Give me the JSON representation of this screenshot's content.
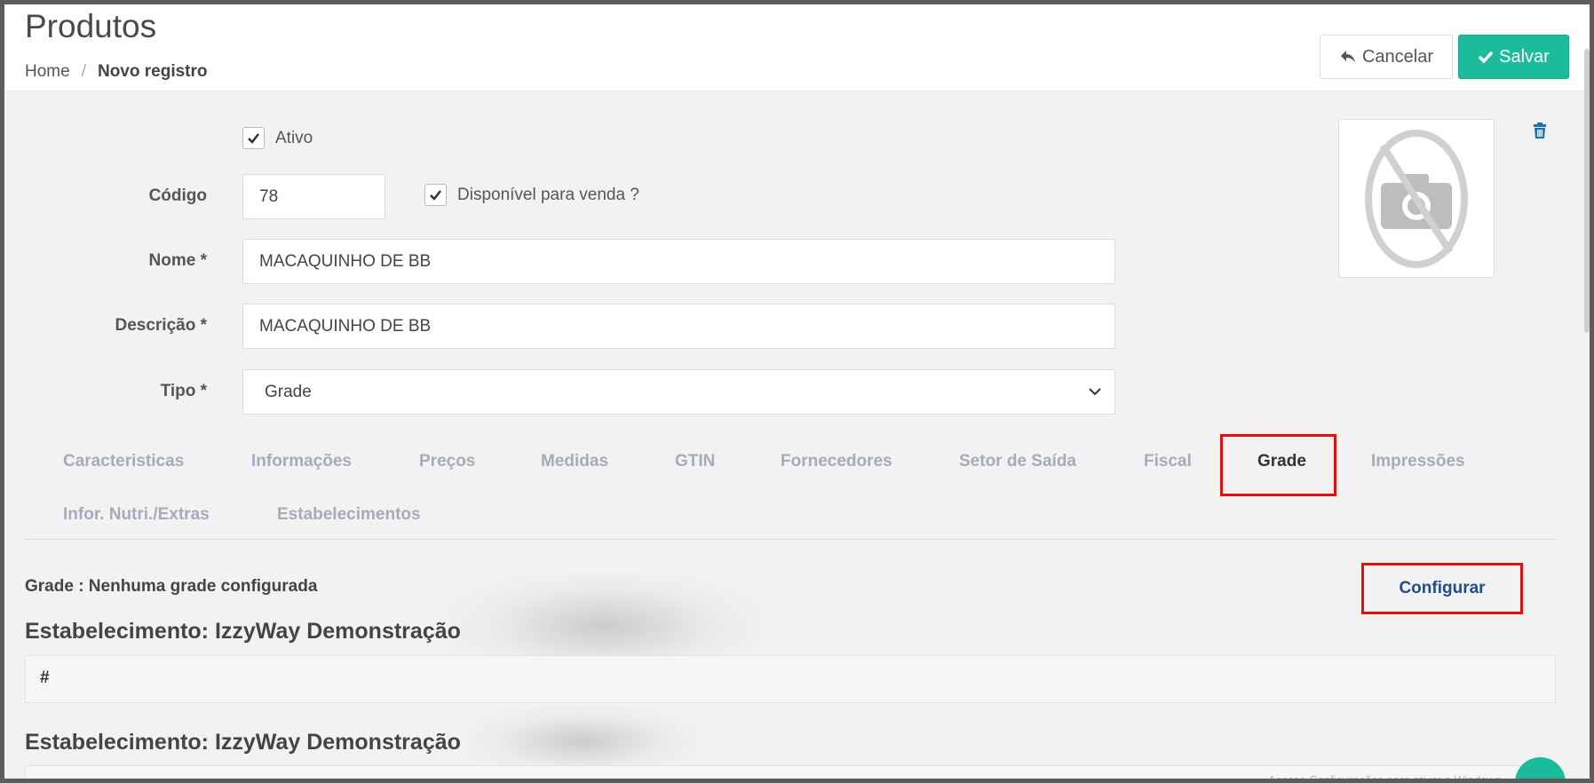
{
  "header": {
    "title": "Produtos",
    "breadcrumb_home": "Home",
    "breadcrumb_separator": "/",
    "breadcrumb_current": "Novo registro",
    "cancel_label": "Cancelar",
    "save_label": "Salvar"
  },
  "form": {
    "ativo_label": "Ativo",
    "ativo_checked": true,
    "codigo_label": "Código",
    "codigo_value": "78",
    "disponivel_label": "Disponível para venda ?",
    "disponivel_checked": true,
    "nome_label": "Nome *",
    "nome_value": "MACAQUINHO DE BB",
    "descricao_label": "Descrição *",
    "descricao_value": "MACAQUINHO DE BB",
    "tipo_label": "Tipo *",
    "tipo_value": "Grade"
  },
  "tabs": [
    {
      "label": "Caracteristicas"
    },
    {
      "label": "Informações"
    },
    {
      "label": "Preços"
    },
    {
      "label": "Medidas"
    },
    {
      "label": "GTIN"
    },
    {
      "label": "Fornecedores"
    },
    {
      "label": "Setor de Saída"
    },
    {
      "label": "Fiscal"
    },
    {
      "label": "Grade",
      "active": true
    },
    {
      "label": "Impressões"
    },
    {
      "label": "Infor. Nutri./Extras"
    },
    {
      "label": "Estabelecimentos"
    }
  ],
  "grade_section": {
    "info": "Grade : Nenhuma grade configurada",
    "configure_label": "Configurar",
    "establishments": [
      {
        "title": "Estabelecimento: IzzyWay Demonstração",
        "table_header": "#"
      },
      {
        "title": "Estabelecimento: IzzyWay Demonstração"
      }
    ]
  },
  "watermark": "Acesse Configurações para ativar o Windows.",
  "colors": {
    "accent": "#1abc9c",
    "highlight": "#e01010",
    "link": "#1f4e8a",
    "delete": "#1f6fb5"
  },
  "icons": {
    "cancel": "undo-arrow-icon",
    "save": "check-icon",
    "photo": "no-photo-icon",
    "delete": "trash-icon"
  }
}
